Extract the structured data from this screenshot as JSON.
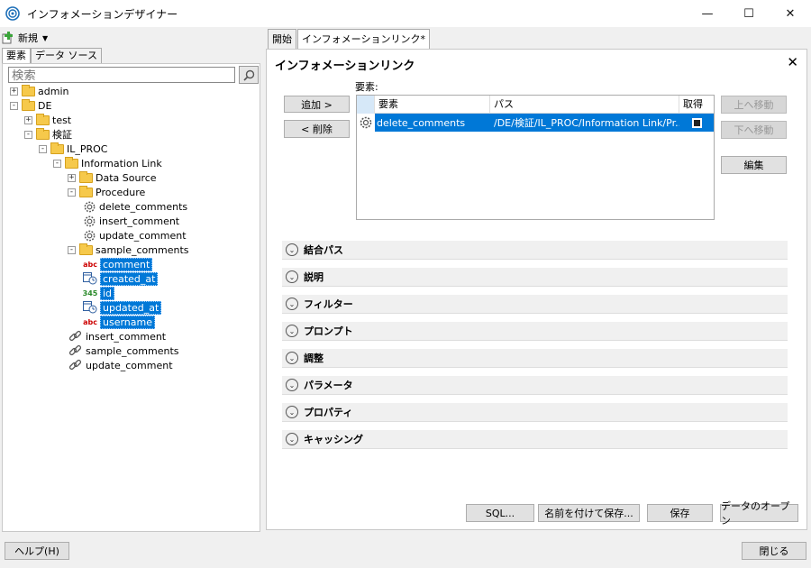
{
  "window": {
    "title": "インフォメーションデザイナー",
    "controls": [
      "—",
      "☐",
      "✕"
    ]
  },
  "left": {
    "new_label": "新規",
    "tabs": [
      "要素",
      "データ ソース"
    ],
    "search_placeholder": "検索",
    "tree": [
      {
        "label": "admin",
        "type": "folder",
        "exp": "+",
        "indent": 0
      },
      {
        "label": "DE",
        "type": "folder",
        "exp": "−",
        "indent": 0
      },
      {
        "label": "test",
        "type": "folder",
        "exp": "+",
        "indent": 1
      },
      {
        "label": "検証",
        "type": "folder",
        "exp": "−",
        "indent": 1
      },
      {
        "label": "IL_PROC",
        "type": "folder",
        "exp": "−",
        "indent": 2
      },
      {
        "label": "Information Link",
        "type": "folder",
        "exp": "−",
        "indent": 3
      },
      {
        "label": "Data Source",
        "type": "folder",
        "exp": "+",
        "indent": 4
      },
      {
        "label": "Procedure",
        "type": "folder",
        "exp": "−",
        "indent": 4
      },
      {
        "label": "delete_comments",
        "type": "procedure",
        "indent": 5
      },
      {
        "label": "insert_comment",
        "type": "procedure",
        "indent": 5
      },
      {
        "label": "update_comment",
        "type": "procedure",
        "indent": 5
      },
      {
        "label": "sample_comments",
        "type": "folder",
        "exp": "−",
        "indent": 4
      },
      {
        "label": "comment",
        "type": "col-abc",
        "indent": 5,
        "selected": true
      },
      {
        "label": "created_at",
        "type": "col-date",
        "indent": 5,
        "selected": true
      },
      {
        "label": "id",
        "type": "col-num",
        "indent": 5,
        "selected": true
      },
      {
        "label": "updated_at",
        "type": "col-date",
        "indent": 5,
        "selected": true
      },
      {
        "label": "username",
        "type": "col-abc",
        "indent": 5,
        "selected": true
      },
      {
        "label": "insert_comment",
        "type": "link",
        "indent": 4
      },
      {
        "label": "sample_comments",
        "type": "link",
        "indent": 4
      },
      {
        "label": "update_comment",
        "type": "link",
        "indent": 4
      }
    ],
    "help_button": "ヘルプ(H)"
  },
  "right": {
    "tabs": [
      "開始",
      "インフォメーションリンク*"
    ],
    "panel_title": "インフォメーションリンク",
    "add_button": "追加 >",
    "remove_button": "< 削除",
    "elements_label": "要素:",
    "table_headers": [
      "要素",
      "パス",
      "取得"
    ],
    "table_rows": [
      {
        "element": "delete_comments",
        "path": "/DE/検証/IL_PROC/Information Link/Pr...",
        "retrieve": true
      }
    ],
    "move_up": "上へ移動",
    "move_down": "下へ移動",
    "edit_button": "編集",
    "sections": [
      "結合パス",
      "説明",
      "フィルター",
      "プロンプト",
      "調整",
      "パラメータ",
      "プロパティ",
      "キャッシング"
    ],
    "sql_button": "SQL...",
    "save_as_button": "名前を付けて保存...",
    "save_button": "保存",
    "open_data_button": "データのオープン",
    "close_button": "閉じる"
  }
}
